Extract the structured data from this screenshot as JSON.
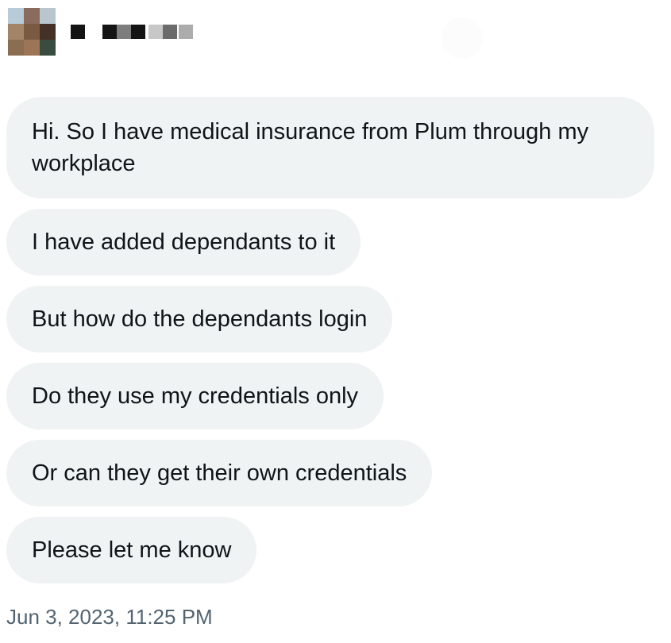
{
  "header": {
    "avatar": {
      "pixels": [
        "#b7cbd8",
        "#8a6c5e",
        "#b9c6cd",
        "#a48469",
        "#7a5b42",
        "#443026",
        "#8b6d52",
        "#9b7556",
        "#3a4b40"
      ]
    },
    "redacted_name_blocks": [
      "#141414",
      "#141414",
      "#7d7d7d",
      "#141414",
      "#c7c7c7",
      "#6b6b6b",
      "#acacac"
    ]
  },
  "messages": [
    {
      "text": "Hi. So I have medical insurance from Plum through my workplace"
    },
    {
      "text": "I have added dependants to it"
    },
    {
      "text": "But how do the dependants login"
    },
    {
      "text": "Do they use my credentials only"
    },
    {
      "text": "Or can they get their own credentials"
    },
    {
      "text": "Please let me know"
    }
  ],
  "timestamp": "Jun 3, 2023, 11:25 PM",
  "colors": {
    "bubble_bg": "#eff3f4",
    "text": "#0f1419",
    "muted_text": "#536471"
  }
}
